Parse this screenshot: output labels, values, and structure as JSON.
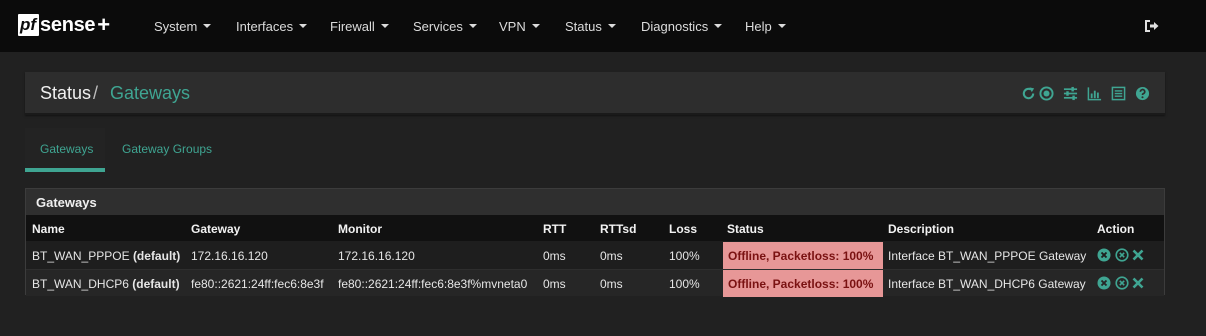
{
  "brand": {
    "logo_pf": "pf",
    "logo_sense": "sense",
    "logo_plus": "+"
  },
  "nav": {
    "items": [
      {
        "label": "System"
      },
      {
        "label": "Interfaces"
      },
      {
        "label": "Firewall"
      },
      {
        "label": "Services"
      },
      {
        "label": "VPN"
      },
      {
        "label": "Status"
      },
      {
        "label": "Diagnostics"
      },
      {
        "label": "Help"
      }
    ],
    "logout_icon": "sign-out-icon"
  },
  "breadcrumb": {
    "parent": "Status",
    "separator": "/",
    "current": "Gateways"
  },
  "header_icons": [
    "refresh-icon",
    "stop-circle-icon",
    "sliders-icon",
    "bar-chart-icon",
    "list-alt-icon",
    "question-circle-icon"
  ],
  "tabs": [
    {
      "label": "Gateways",
      "active": true
    },
    {
      "label": "Gateway Groups",
      "active": false
    }
  ],
  "panel": {
    "title": "Gateways"
  },
  "table": {
    "columns": [
      "Name",
      "Gateway",
      "Monitor",
      "RTT",
      "RTTsd",
      "Loss",
      "Status",
      "Description",
      "Action"
    ],
    "rows": [
      {
        "name": "BT_WAN_PPPOE",
        "default_tag": "(default)",
        "gateway": "172.16.16.120",
        "monitor": "172.16.16.120",
        "rtt": "0ms",
        "rttsd": "0ms",
        "loss": "100%",
        "status": "Offline, Packetloss: 100%",
        "description": "Interface BT_WAN_PPPOE Gateway",
        "actions": [
          "times-circle-icon",
          "ban-circle-icon",
          "close-icon"
        ]
      },
      {
        "name": "BT_WAN_DHCP6",
        "default_tag": "(default)",
        "gateway": "fe80::2621:24ff:fec6:8e3f",
        "monitor": "fe80::2621:24ff:fec6:8e3f%mvneta0",
        "rtt": "0ms",
        "rttsd": "0ms",
        "loss": "100%",
        "status": "Offline, Packetloss: 100%",
        "description": "Interface BT_WAN_DHCP6 Gateway",
        "actions": [
          "times-circle-icon",
          "ban-circle-icon",
          "close-icon"
        ]
      }
    ]
  },
  "colors": {
    "accent": "#3fa592",
    "navbar": "#0b0b0b",
    "background": "#212121",
    "status_offline_bg": "#e79797",
    "status_offline_text": "#7a1212"
  }
}
